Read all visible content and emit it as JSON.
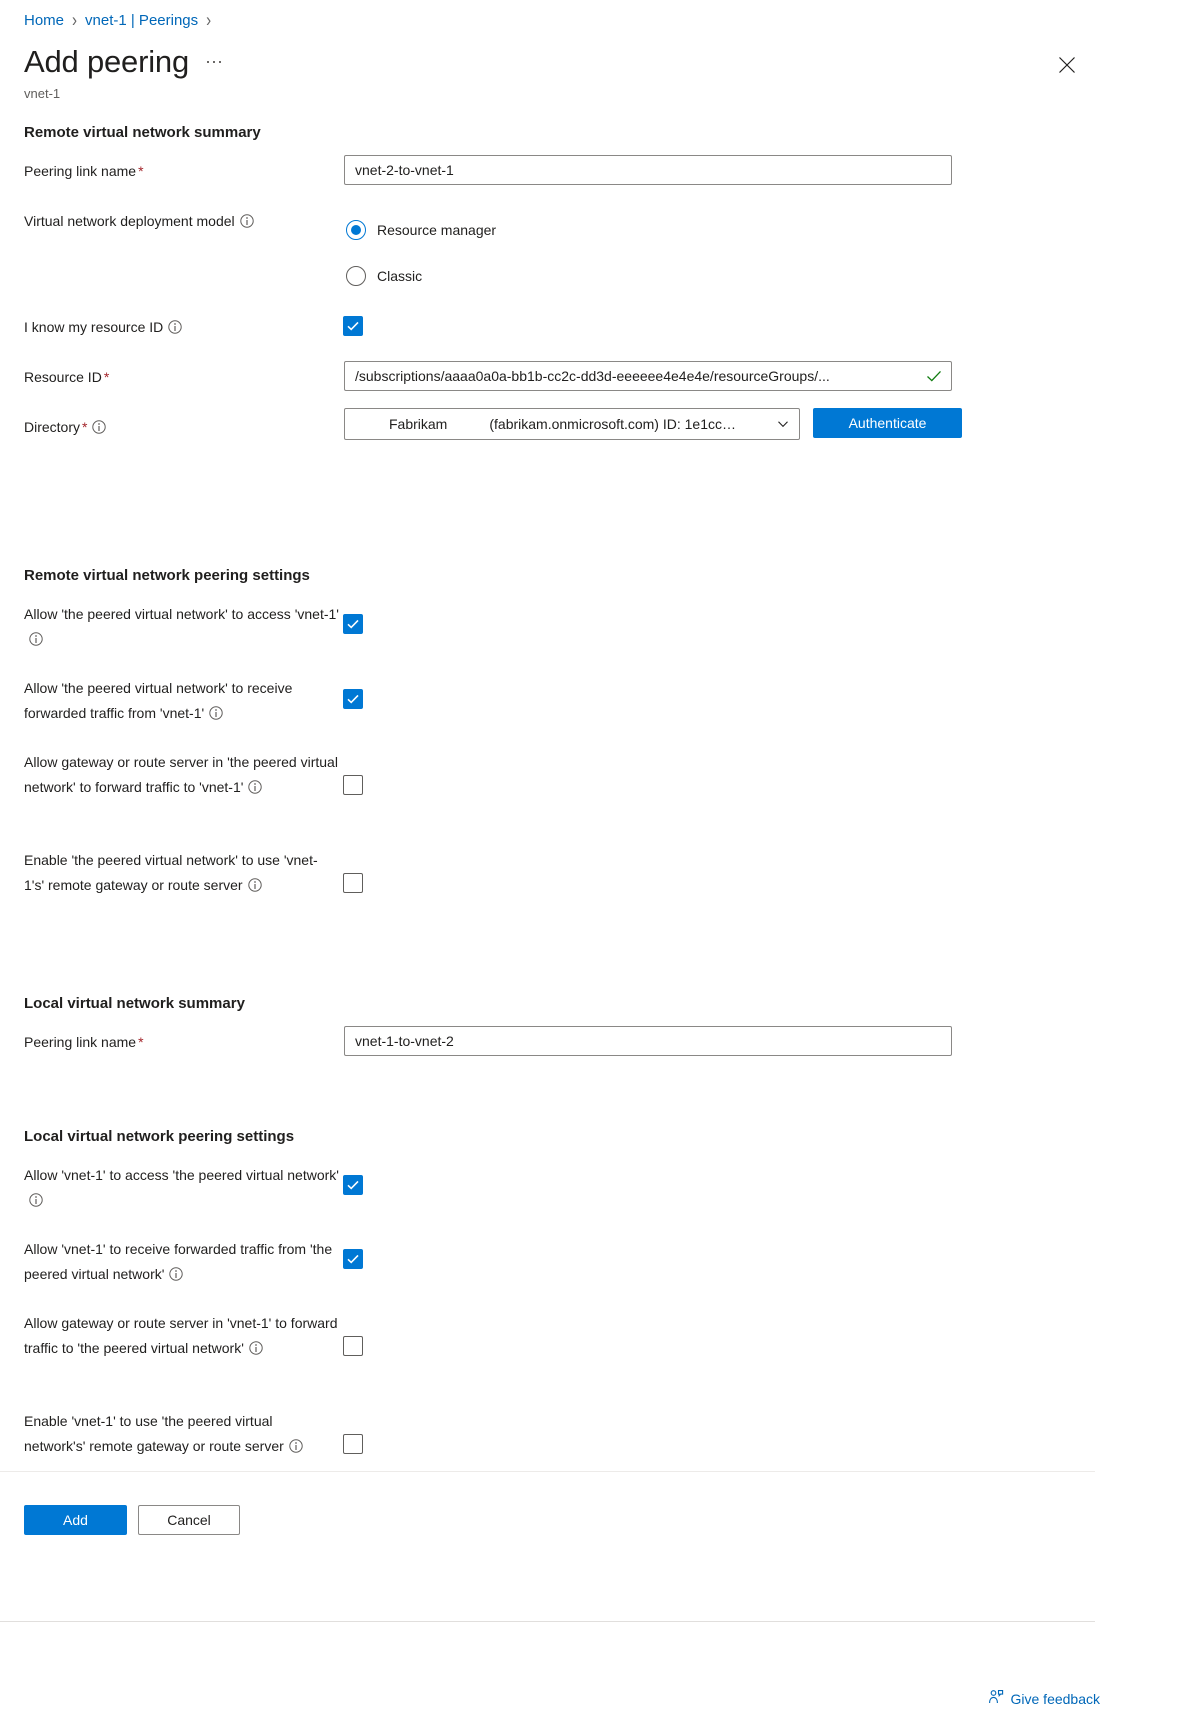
{
  "breadcrumb": {
    "items": [
      {
        "label": "Home"
      },
      {
        "label": "vnet-1 | Peerings"
      }
    ],
    "separator": "›"
  },
  "header": {
    "title": "Add peering",
    "ellipsis": "⋯",
    "subtitle": "vnet-1",
    "close_icon": "close-icon"
  },
  "remote_summary": {
    "section_title": "Remote virtual network summary",
    "peering_link_name": {
      "label": "Peering link name",
      "required": "*",
      "value": "vnet-2-to-vnet-1"
    },
    "deployment_model": {
      "label": "Virtual network deployment model",
      "info_icon": "info-icon",
      "options": [
        {
          "label": "Resource manager",
          "checked": true
        },
        {
          "label": "Classic",
          "checked": false
        }
      ]
    },
    "know_resource_id": {
      "label": "I know my resource ID",
      "info_icon": "info-icon",
      "checked": true
    },
    "resource_id": {
      "label": "Resource ID",
      "required": "*",
      "value": "/subscriptions/aaaa0a0a-bb1b-cc2c-dd3d-eeeeee4e4e4e/resourceGroups/...",
      "valid_icon": "checkmark-icon"
    },
    "directory": {
      "label": "Directory",
      "required": "*",
      "info_icon": "info-icon",
      "name": "Fabrikam",
      "detail": "(fabrikam.onmicrosoft.com) ID: 1e1cc…",
      "chevron_icon": "chevron-down-icon",
      "authenticate_label": "Authenticate"
    }
  },
  "remote_settings": {
    "section_title": "Remote virtual network peering settings",
    "items": [
      {
        "label": "Allow 'the peered virtual network' to access 'vnet-1'",
        "info_icon": "info-icon",
        "checked": true
      },
      {
        "label": "Allow 'the peered virtual network' to receive forwarded traffic from 'vnet-1'",
        "info_icon": "info-icon",
        "checked": true
      },
      {
        "label": "Allow gateway or route server in 'the peered virtual network' to forward traffic to 'vnet-1'",
        "info_icon": "info-icon",
        "checked": false
      },
      {
        "label": "Enable 'the peered virtual network' to use 'vnet-1's' remote gateway or route server",
        "info_icon": "info-icon",
        "checked": false
      }
    ]
  },
  "local_summary": {
    "section_title": "Local virtual network summary",
    "peering_link_name": {
      "label": "Peering link name",
      "required": "*",
      "value": "vnet-1-to-vnet-2"
    }
  },
  "local_settings": {
    "section_title": "Local virtual network peering settings",
    "items": [
      {
        "label": "Allow 'vnet-1' to access 'the peered virtual network'",
        "info_icon": "info-icon",
        "checked": true
      },
      {
        "label": "Allow 'vnet-1' to receive forwarded traffic from 'the peered virtual network'",
        "info_icon": "info-icon",
        "checked": true
      },
      {
        "label": "Allow gateway or route server in 'vnet-1' to forward traffic to 'the peered virtual network'",
        "info_icon": "info-icon",
        "checked": false
      },
      {
        "label": "Enable 'vnet-1' to use 'the peered virtual network's' remote gateway or route server",
        "info_icon": "info-icon",
        "checked": false
      }
    ]
  },
  "footer": {
    "add_label": "Add",
    "cancel_label": "Cancel",
    "feedback_label": "Give feedback",
    "feedback_icon": "feedback-person-icon"
  },
  "colors": {
    "accent": "#0078d4",
    "link": "#0067b8",
    "required": "#a4262c",
    "valid": "#107c10"
  }
}
